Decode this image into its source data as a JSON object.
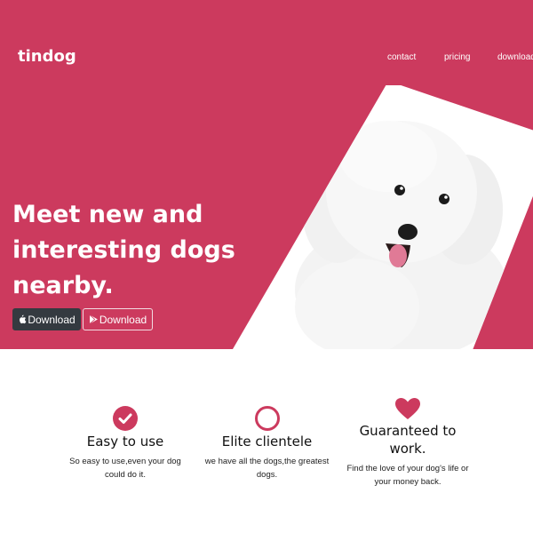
{
  "navbar": {
    "brand": "tindog",
    "links": [
      "contact",
      "pricing",
      "download"
    ]
  },
  "hero": {
    "title": "Meet new and interesting dogs nearby.",
    "buttons": [
      {
        "label": "Download",
        "icon": "apple-icon"
      },
      {
        "label": "Download",
        "icon": "play-store-icon"
      }
    ],
    "image": "dog-photo"
  },
  "features": [
    {
      "icon": "check-circle-icon",
      "title": "Easy to use",
      "text": "So easy to use,even your dog could do it."
    },
    {
      "icon": "circle-outline-icon",
      "title": "Elite clientele",
      "text": "we have all the dogs,the greatest dogs."
    },
    {
      "icon": "heart-icon",
      "title": "Guaranteed to work.",
      "text": "Find the love of your dog's life or your money back."
    }
  ],
  "colors": {
    "accent": "#cc3a5e",
    "dark_button": "#343a40"
  }
}
